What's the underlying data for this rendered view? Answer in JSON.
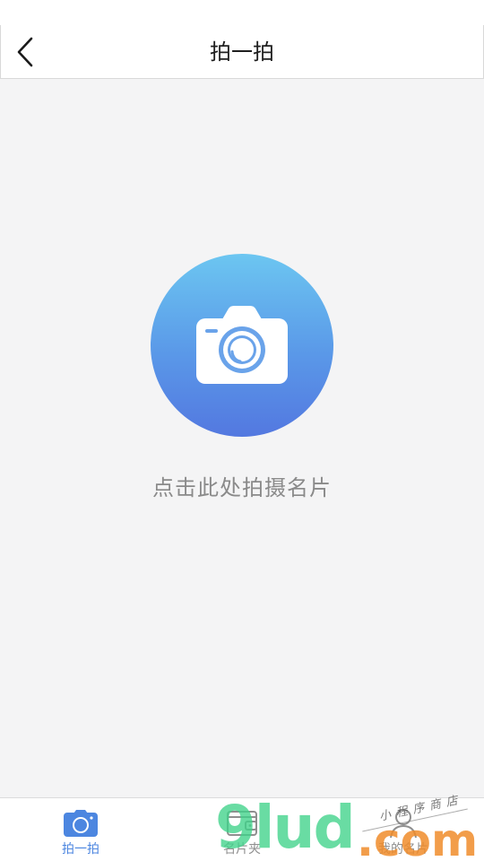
{
  "header": {
    "title": "拍一拍",
    "back_icon": "chevron-left-icon"
  },
  "main": {
    "capture_icon": "camera-icon",
    "capture_hint": "点击此处拍摄名片",
    "accent_gradient": [
      "#6cc6f1",
      "#5378e0"
    ]
  },
  "tabbar": {
    "items": [
      {
        "label": "拍一拍",
        "icon": "camera-icon",
        "active": true
      },
      {
        "label": "名片夹",
        "icon": "wallet-icon",
        "active": false
      },
      {
        "label": "我的名片",
        "icon": "user-icon",
        "active": false
      }
    ],
    "active_color": "#4c86e0",
    "inactive_color": "#8f8f8f"
  },
  "watermark": {
    "brand": "9lud",
    "domain": ".com",
    "tagline": "小程序商店"
  }
}
